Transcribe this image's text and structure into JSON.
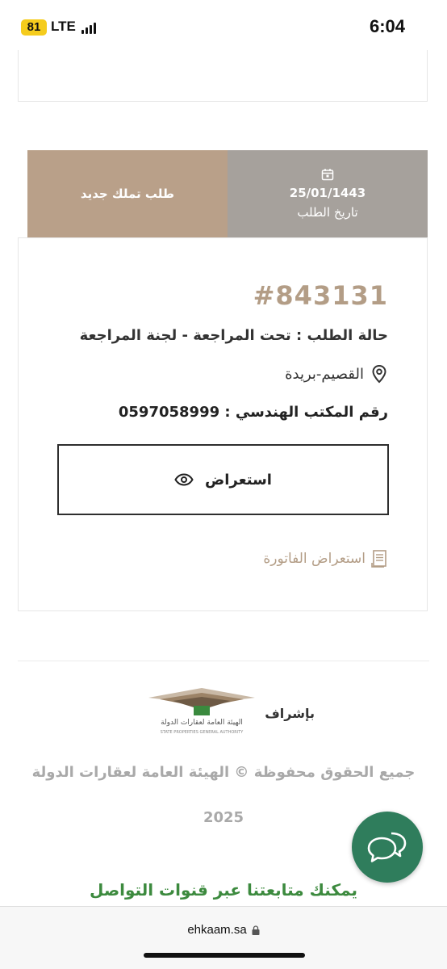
{
  "status_bar": {
    "battery": "81",
    "network": "LTE",
    "time": "6:04"
  },
  "order": {
    "type": "طلب تملك جديد",
    "date_value": "25/01/1443",
    "date_label": "تاريخ الطلب",
    "id": "#843131",
    "status": "حالة الطلب : تحت المراجعة - لجنة المراجعة",
    "location": "القصيم-بريدة",
    "office_phone": "رقم المكتب الهندسي : 0597058999",
    "view_button": "استعراض",
    "invoice_link": "استعراض الفاتورة"
  },
  "footer": {
    "supervision": "بإشراف",
    "logo_text_ar": "الهيئة العامة لعقارات الدولة",
    "logo_text_en": "STATE PROPERTIES GENERAL AUTHORITY",
    "rights": "جميع الحقوق محفوظة © الهيئة العامة لعقارات الدولة",
    "year": "2025",
    "follow": "يمكنك متابعتنا عبر قنوات التواصل"
  },
  "browser": {
    "url": "ehkaam.sa"
  },
  "colors": {
    "accent_tan": "#b9a089",
    "grey_tab": "#a6a19c",
    "id_color": "#b39d86",
    "chat_green": "#2f7d5c",
    "follow_green": "#3c8a3e"
  },
  "icons": [
    "calendar-icon",
    "location-pin-icon",
    "eye-icon",
    "invoice-icon",
    "chat-icon",
    "lock-icon"
  ]
}
